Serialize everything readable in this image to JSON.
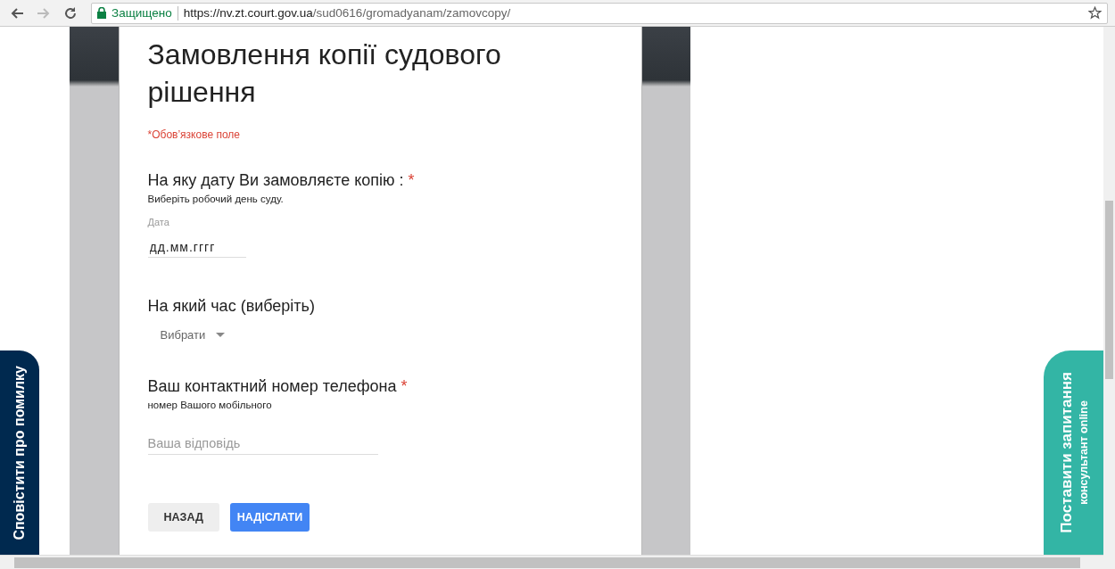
{
  "browser": {
    "secure_label": "Защищено",
    "url_host": "https://nv.zt.court.gov.ua",
    "url_path": "/sud0616/gromadyanam/zamovcopy/"
  },
  "form": {
    "title": "Замовлення копії судового рішення",
    "required_note": "*Обов’язкове поле",
    "required_mark": "*",
    "questions": [
      {
        "kind": "date",
        "title": "На яку дату Ви замовляєте копію :",
        "required": true,
        "description": "Виберіть робочий день суду.",
        "field_label": "Дата",
        "value": "дд.мм.гггг"
      },
      {
        "kind": "dropdown",
        "title": "На який час (виберіть)",
        "required": false,
        "value": "Вибрати"
      },
      {
        "kind": "text",
        "title": "Ваш контактний номер телефона",
        "required": true,
        "description": "номер Вашого мобільного",
        "placeholder": "Ваша відповідь"
      }
    ],
    "buttons": [
      {
        "label": "НАЗАД",
        "kind": "secondary"
      },
      {
        "label": "НАДІСЛАТИ",
        "kind": "primary"
      }
    ]
  },
  "left_tab": {
    "label": "Сповістити про помилку"
  },
  "right_tab": {
    "title": "Поставити запитання",
    "subtitle": "консультант online"
  }
}
